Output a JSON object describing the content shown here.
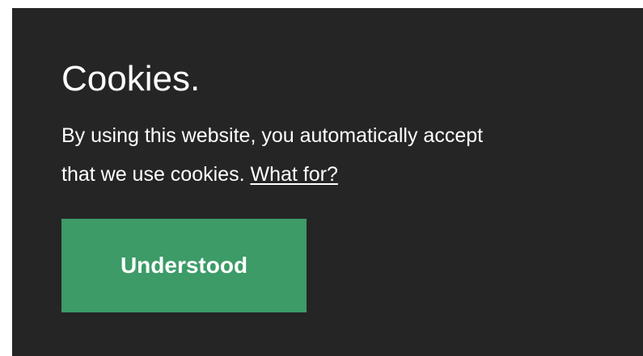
{
  "cookie_banner": {
    "title": "Cookies.",
    "message_line1": "By using this website, you automatically accept",
    "message_line2_prefix": "that we use cookies.",
    "link_label": "What for?",
    "button_label": "Understood",
    "colors": {
      "background": "#252525",
      "text": "#ffffff",
      "button": "#3c9b67"
    }
  }
}
